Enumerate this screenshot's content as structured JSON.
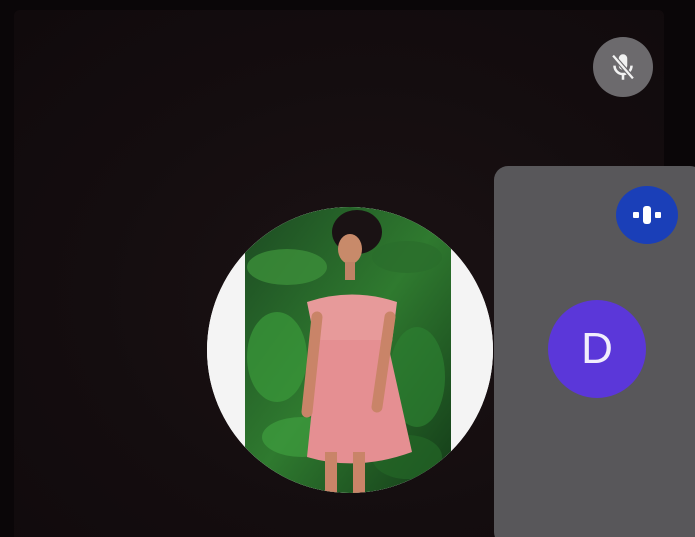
{
  "pip": {
    "avatar_initial": "D",
    "avatar_color": "#5b37d9"
  },
  "icons": {
    "mute": "mic-off-icon",
    "pin": "pin-icon"
  },
  "colors": {
    "background": "#0a0608",
    "pip_tile": "#58575a",
    "pin_button": "#1a3fb8",
    "mute_button": "#6c6a6d"
  }
}
